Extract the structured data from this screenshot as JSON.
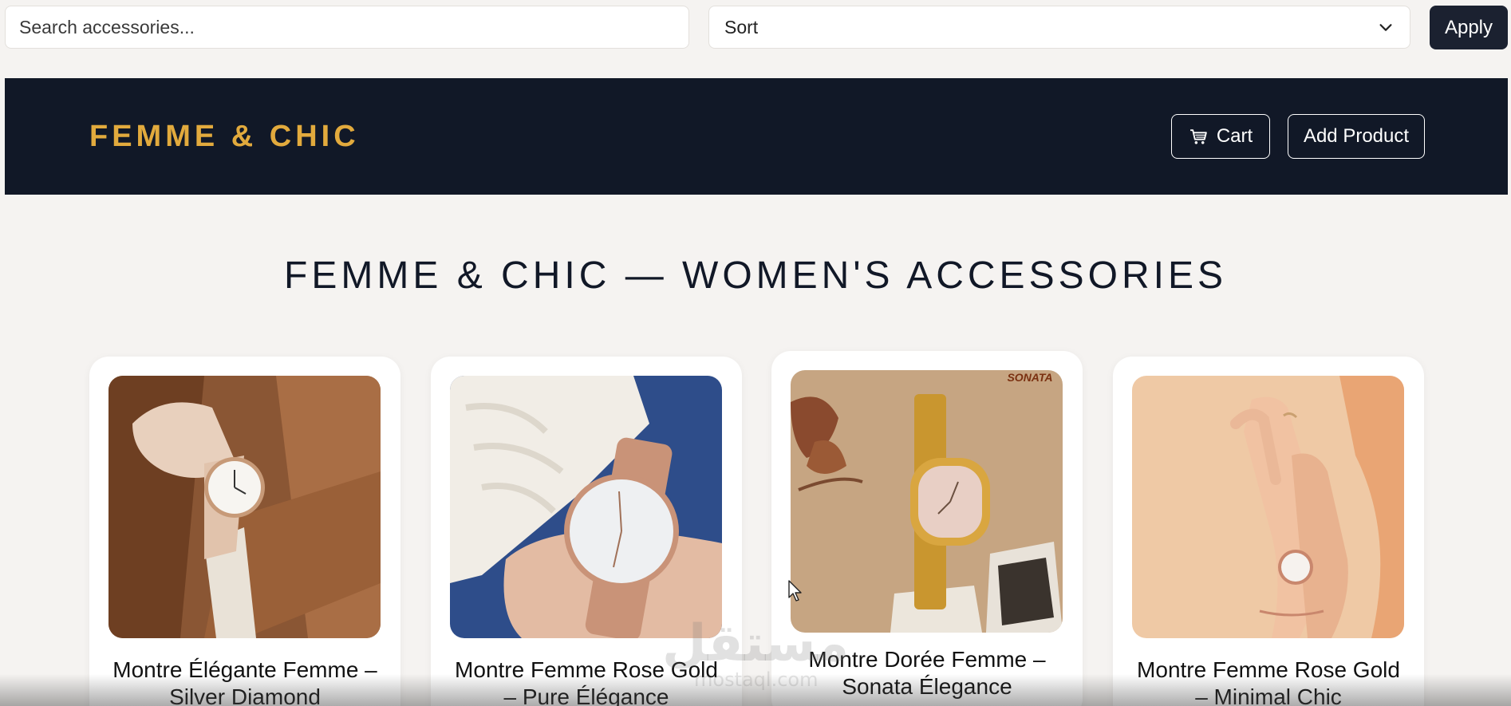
{
  "controls": {
    "search_placeholder": "Search accessories...",
    "sort_label": "Sort",
    "apply_label": "Apply"
  },
  "header": {
    "brand": "FEMME & CHIC",
    "cart_label": "Cart",
    "cart_icon": "cart-icon",
    "add_product_label": "Add Product"
  },
  "main": {
    "title": "FEMME & CHIC — WOMEN'S ACCESSORIES",
    "products": [
      {
        "name": "Montre Élégante Femme – Silver Diamond"
      },
      {
        "name": "Montre Femme Rose Gold – Pure Élégance"
      },
      {
        "name": "Montre Dorée Femme – Sonata Élegance"
      },
      {
        "name": "Montre Femme Rose Gold – Minimal Chic"
      }
    ]
  },
  "image_texts": {
    "sonata_logo": "SONATA"
  },
  "watermark": {
    "text": "مستقل",
    "sub": "mostaql.com"
  },
  "colors": {
    "page_bg": "#f5f3f1",
    "header_bg": "#111827",
    "brand_gold": "#e2aa3d",
    "apply_bg": "#1b2130"
  }
}
